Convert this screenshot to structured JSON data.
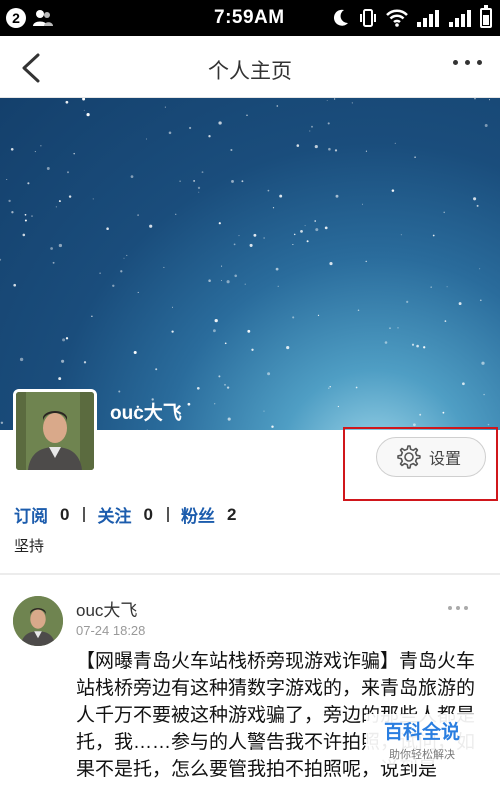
{
  "status_bar": {
    "notification_count": "2",
    "time": "7:59AM",
    "icons": [
      "notification-badge",
      "user-contact-icon",
      "moon-icon",
      "vibrate-icon",
      "wifi-icon",
      "signal-icon",
      "signal-icon",
      "battery-icon"
    ]
  },
  "navbar": {
    "title": "个人主页",
    "back_icon": "chevron-left-icon",
    "more_icon": "more-dots-icon"
  },
  "profile": {
    "name": "ouc大飞",
    "settings_label": "设置",
    "settings_icon": "gear-icon",
    "stats": [
      {
        "label": "订阅",
        "value": "0"
      },
      {
        "label": "关注",
        "value": "0"
      },
      {
        "label": "粉丝",
        "value": "2"
      }
    ],
    "bio": "坚持"
  },
  "post": {
    "author": "ouc大飞",
    "time": "07-24 18:28",
    "body": "【网曝青岛火车站栈桥旁现游戏诈骗】青岛火车站栈桥旁边有这种猜数字游戏的，来青岛旅游的人千万不要被这种游戏骗了，旁边的那些人都是托，我……参与的人警告我不许拍照，试问，如果不是托，怎么要管我拍不拍照呢，说到是"
  },
  "watermark": {
    "title": "百科全说",
    "subtitle": "助你轻松解决"
  },
  "colors": {
    "link_blue": "#1c5cad",
    "highlight_red": "#d0161b",
    "watermark_blue": "#2a7ee0"
  }
}
